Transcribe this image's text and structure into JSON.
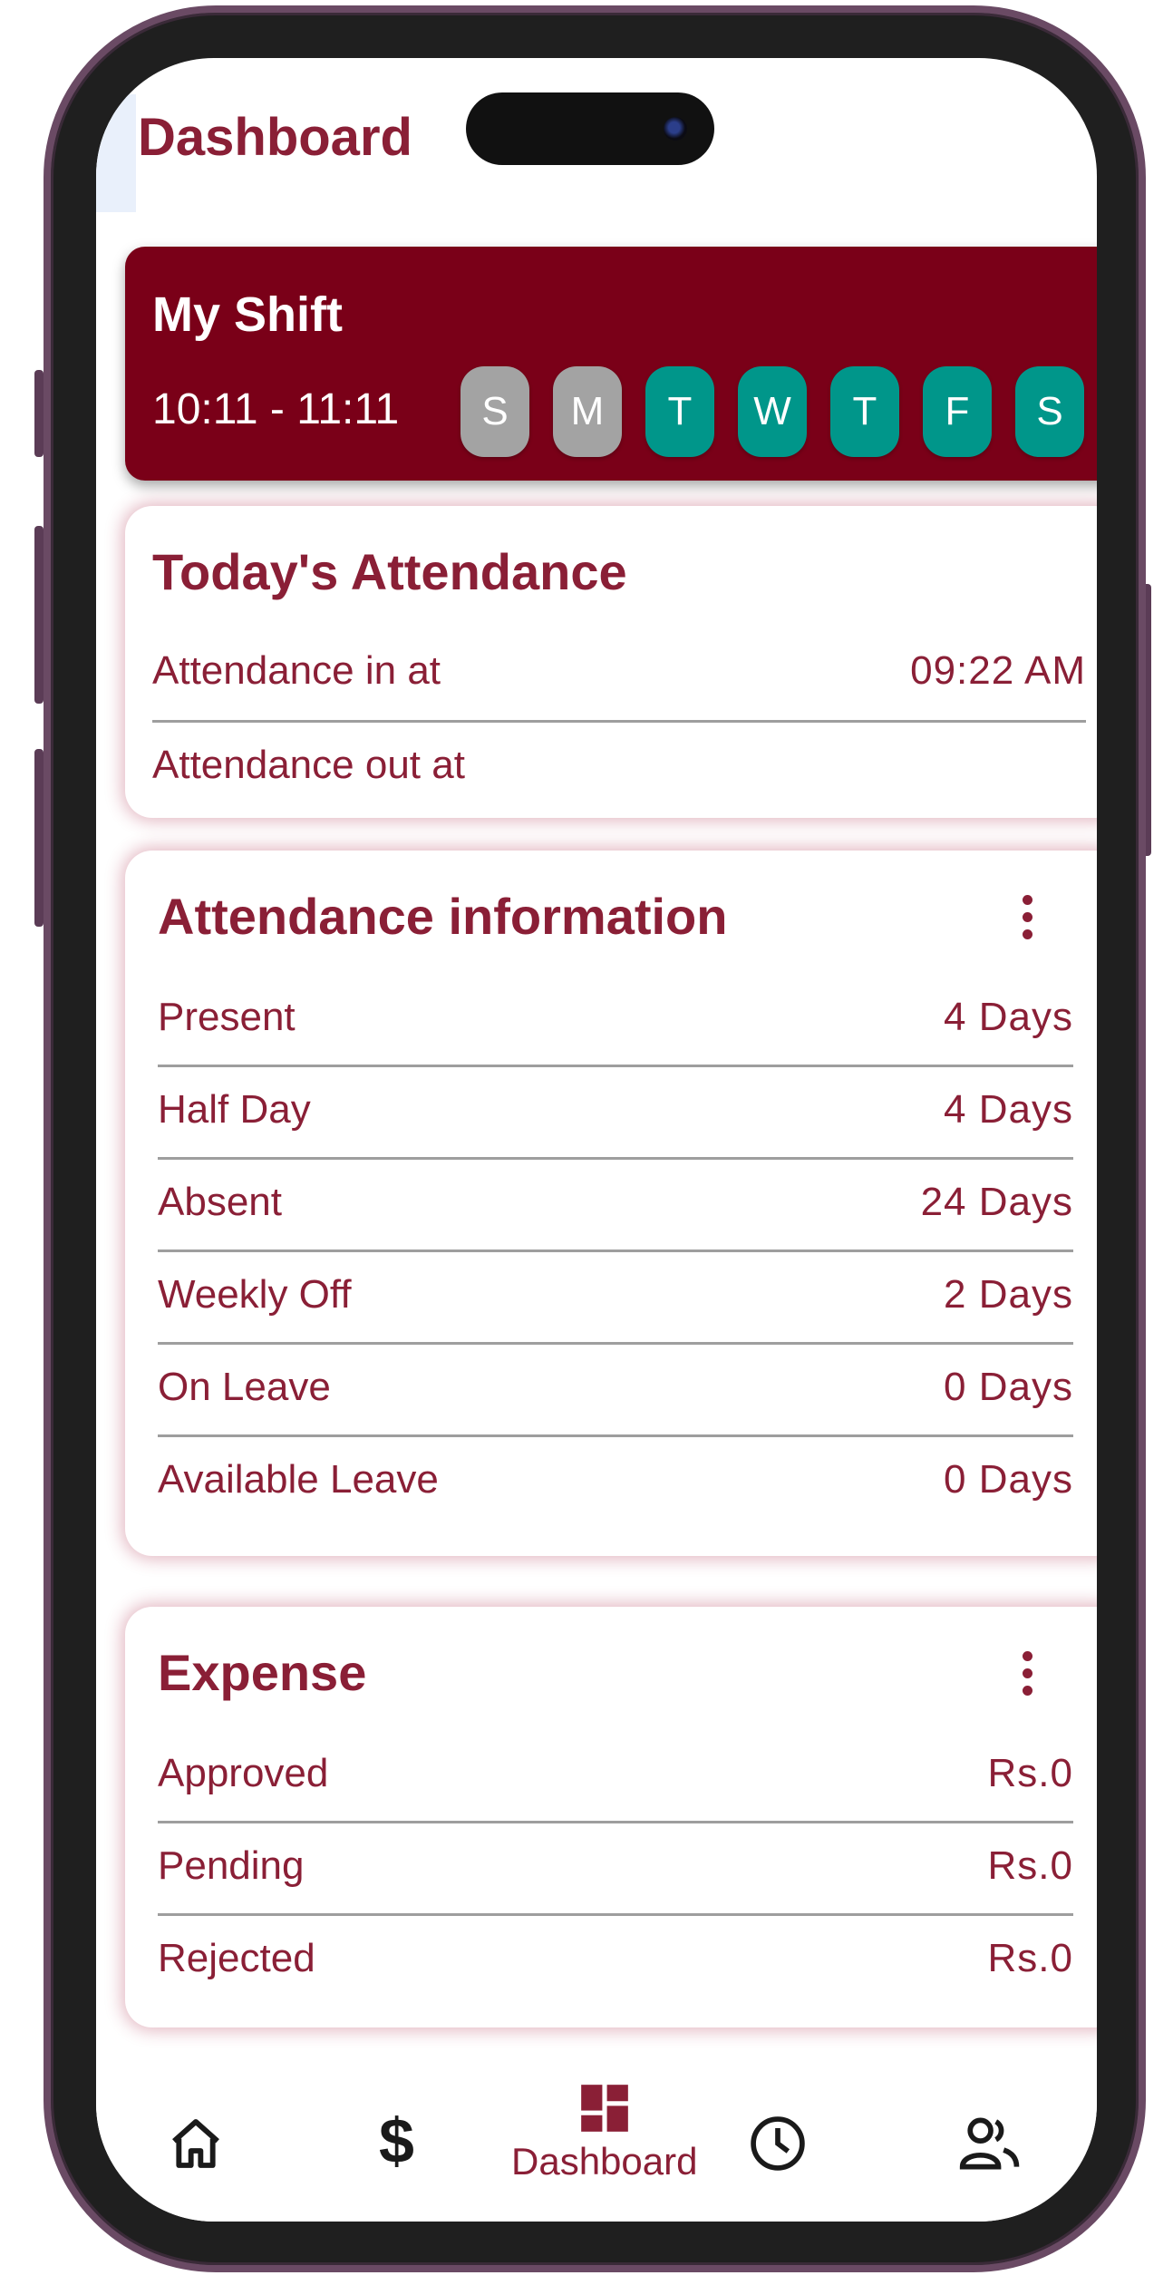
{
  "header": {
    "title": "Dashboard"
  },
  "shift": {
    "title": "My Shift",
    "time": "10:11 - 11:11",
    "days": [
      {
        "label": "S",
        "active": false
      },
      {
        "label": "M",
        "active": false
      },
      {
        "label": "T",
        "active": true
      },
      {
        "label": "W",
        "active": true
      },
      {
        "label": "T",
        "active": true
      },
      {
        "label": "F",
        "active": true
      },
      {
        "label": "S",
        "active": true
      }
    ]
  },
  "today": {
    "title": "Today's Attendance",
    "rows": [
      {
        "label": "Attendance in at",
        "value": "09:22 AM"
      },
      {
        "label": "Attendance out at",
        "value": ""
      }
    ]
  },
  "attendance_info": {
    "title": "Attendance information",
    "rows": [
      {
        "label": "Present",
        "value": "4 Days"
      },
      {
        "label": "Half Day",
        "value": "4 Days"
      },
      {
        "label": "Absent",
        "value": "24 Days"
      },
      {
        "label": "Weekly Off",
        "value": "2 Days"
      },
      {
        "label": "On Leave",
        "value": "0 Days"
      },
      {
        "label": "Available Leave",
        "value": "0 Days"
      }
    ]
  },
  "expense": {
    "title": "Expense",
    "rows": [
      {
        "label": "Approved",
        "value": "Rs.0"
      },
      {
        "label": "Pending",
        "value": "Rs.0"
      },
      {
        "label": "Rejected",
        "value": "Rs.0"
      }
    ]
  },
  "nav": {
    "items": [
      {
        "icon": "home-icon",
        "label": ""
      },
      {
        "icon": "dollar-icon",
        "label": ""
      },
      {
        "icon": "dashboard-icon",
        "label": "Dashboard",
        "active": true
      },
      {
        "icon": "clock-icon",
        "label": ""
      },
      {
        "icon": "people-icon",
        "label": ""
      }
    ]
  },
  "colors": {
    "brand": "#8a1f36",
    "shift_bg": "#7a0018",
    "day_on": "#00968a",
    "day_off": "#a3a3a3"
  }
}
